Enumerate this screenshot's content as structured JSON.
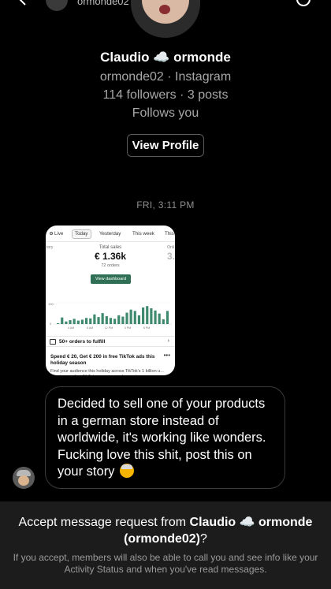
{
  "header": {
    "username": "ormonde02"
  },
  "profile": {
    "name": "Claudio ☁️ ormonde",
    "handle_line": "ormonde02 · Instagram",
    "stats_line": "114 followers · 3 posts",
    "follow_status": "Follows you",
    "view_profile_label": "View Profile"
  },
  "timestamp": "FRI, 3:11 PM",
  "shared_image": {
    "tabs": [
      "Live",
      "Today",
      "Yesterday",
      "This week",
      "This"
    ],
    "left_cut_label": "tory",
    "right_cut_label": "Onli",
    "right_cut_value": "3.",
    "total_sales_label": "Total sales",
    "total_sales_value": "€ 1.36k",
    "orders_label": "72 orders",
    "view_dashboard_label": "View dashboard",
    "y_axis_label": "100",
    "y_axis_zero": "0",
    "x_ticks": [
      "4 AM",
      "8 AM",
      "12 PM",
      "4 PM",
      "8 PM"
    ],
    "bar_values": [
      2,
      15,
      6,
      9,
      12,
      8,
      10,
      14,
      13,
      22,
      16,
      25,
      18,
      14,
      12,
      20,
      17,
      26,
      33,
      30,
      20,
      38,
      41,
      36,
      31,
      24,
      11,
      30
    ],
    "orders_row_label": "50+ orders to fulfill",
    "promo_title": "Spend € 20, Get € 200 in free TikTok ads this holiday season",
    "promo_body": "Find your audience this holiday across TikTok's 1 billion u... Create your first TikTok campaign and spend..."
  },
  "message": {
    "text": "Decided to sell one of your products in a german store instead of worldwide, it's working like wonders. Fucking love this shit, post this on your story",
    "emoji": "cowboy-face"
  },
  "request": {
    "prefix": "Accept message request from ",
    "name": "Claudio ☁️ ormonde",
    "handle": "(ormonde02)",
    "suffix": "?",
    "note": "If you accept, members will also be able to call you and see info like your Activity Status and when you've read messages."
  }
}
